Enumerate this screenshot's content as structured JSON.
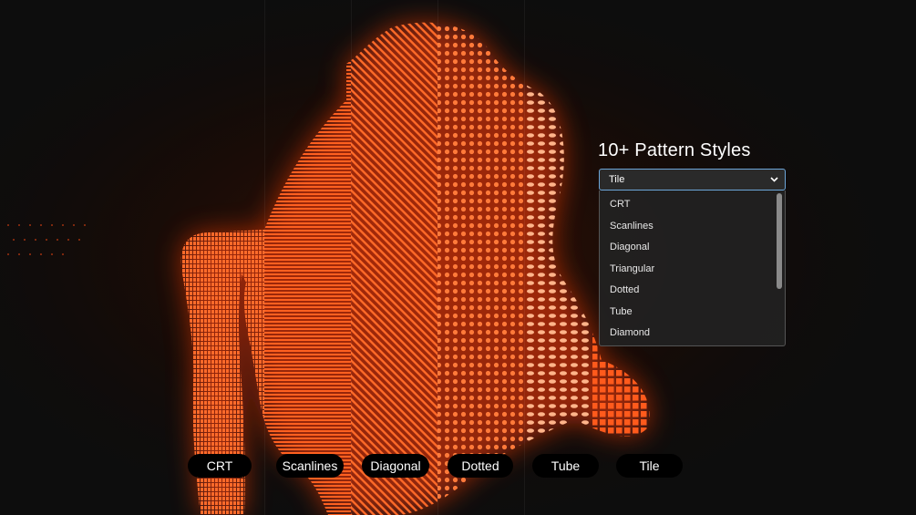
{
  "heading": "10+ Pattern Styles",
  "select": {
    "value": "Tile",
    "icon": "chevron-down-icon"
  },
  "options": [
    "CRT",
    "Scanlines",
    "Diagonal",
    "Triangular",
    "Dotted",
    "Tube",
    "Diamond"
  ],
  "pills": [
    "CRT",
    "Scanlines",
    "Diagonal",
    "Dotted",
    "Tube",
    "Tile"
  ],
  "colors": {
    "background": "#0d0d0d",
    "glow": "#ff4a10",
    "accent": "#ff7a2e",
    "highlight": "#ffd2a8",
    "select_border": "#6da6d9"
  }
}
